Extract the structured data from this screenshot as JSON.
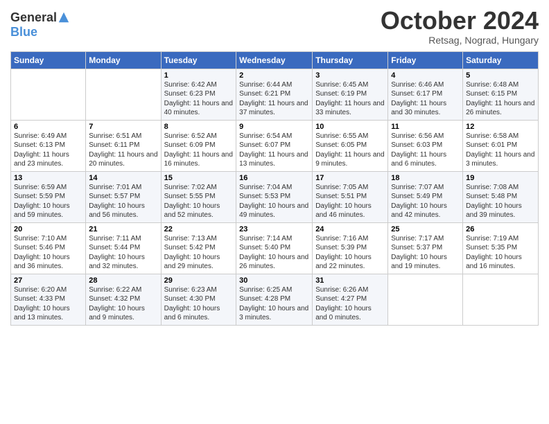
{
  "header": {
    "logo_line1": "General",
    "logo_line2": "Blue",
    "month": "October 2024",
    "location": "Retsag, Nograd, Hungary"
  },
  "days_of_week": [
    "Sunday",
    "Monday",
    "Tuesday",
    "Wednesday",
    "Thursday",
    "Friday",
    "Saturday"
  ],
  "weeks": [
    [
      {
        "day": "",
        "info": ""
      },
      {
        "day": "",
        "info": ""
      },
      {
        "day": "1",
        "info": "Sunrise: 6:42 AM\nSunset: 6:23 PM\nDaylight: 11 hours and 40 minutes."
      },
      {
        "day": "2",
        "info": "Sunrise: 6:44 AM\nSunset: 6:21 PM\nDaylight: 11 hours and 37 minutes."
      },
      {
        "day": "3",
        "info": "Sunrise: 6:45 AM\nSunset: 6:19 PM\nDaylight: 11 hours and 33 minutes."
      },
      {
        "day": "4",
        "info": "Sunrise: 6:46 AM\nSunset: 6:17 PM\nDaylight: 11 hours and 30 minutes."
      },
      {
        "day": "5",
        "info": "Sunrise: 6:48 AM\nSunset: 6:15 PM\nDaylight: 11 hours and 26 minutes."
      }
    ],
    [
      {
        "day": "6",
        "info": "Sunrise: 6:49 AM\nSunset: 6:13 PM\nDaylight: 11 hours and 23 minutes."
      },
      {
        "day": "7",
        "info": "Sunrise: 6:51 AM\nSunset: 6:11 PM\nDaylight: 11 hours and 20 minutes."
      },
      {
        "day": "8",
        "info": "Sunrise: 6:52 AM\nSunset: 6:09 PM\nDaylight: 11 hours and 16 minutes."
      },
      {
        "day": "9",
        "info": "Sunrise: 6:54 AM\nSunset: 6:07 PM\nDaylight: 11 hours and 13 minutes."
      },
      {
        "day": "10",
        "info": "Sunrise: 6:55 AM\nSunset: 6:05 PM\nDaylight: 11 hours and 9 minutes."
      },
      {
        "day": "11",
        "info": "Sunrise: 6:56 AM\nSunset: 6:03 PM\nDaylight: 11 hours and 6 minutes."
      },
      {
        "day": "12",
        "info": "Sunrise: 6:58 AM\nSunset: 6:01 PM\nDaylight: 11 hours and 3 minutes."
      }
    ],
    [
      {
        "day": "13",
        "info": "Sunrise: 6:59 AM\nSunset: 5:59 PM\nDaylight: 10 hours and 59 minutes."
      },
      {
        "day": "14",
        "info": "Sunrise: 7:01 AM\nSunset: 5:57 PM\nDaylight: 10 hours and 56 minutes."
      },
      {
        "day": "15",
        "info": "Sunrise: 7:02 AM\nSunset: 5:55 PM\nDaylight: 10 hours and 52 minutes."
      },
      {
        "day": "16",
        "info": "Sunrise: 7:04 AM\nSunset: 5:53 PM\nDaylight: 10 hours and 49 minutes."
      },
      {
        "day": "17",
        "info": "Sunrise: 7:05 AM\nSunset: 5:51 PM\nDaylight: 10 hours and 46 minutes."
      },
      {
        "day": "18",
        "info": "Sunrise: 7:07 AM\nSunset: 5:49 PM\nDaylight: 10 hours and 42 minutes."
      },
      {
        "day": "19",
        "info": "Sunrise: 7:08 AM\nSunset: 5:48 PM\nDaylight: 10 hours and 39 minutes."
      }
    ],
    [
      {
        "day": "20",
        "info": "Sunrise: 7:10 AM\nSunset: 5:46 PM\nDaylight: 10 hours and 36 minutes."
      },
      {
        "day": "21",
        "info": "Sunrise: 7:11 AM\nSunset: 5:44 PM\nDaylight: 10 hours and 32 minutes."
      },
      {
        "day": "22",
        "info": "Sunrise: 7:13 AM\nSunset: 5:42 PM\nDaylight: 10 hours and 29 minutes."
      },
      {
        "day": "23",
        "info": "Sunrise: 7:14 AM\nSunset: 5:40 PM\nDaylight: 10 hours and 26 minutes."
      },
      {
        "day": "24",
        "info": "Sunrise: 7:16 AM\nSunset: 5:39 PM\nDaylight: 10 hours and 22 minutes."
      },
      {
        "day": "25",
        "info": "Sunrise: 7:17 AM\nSunset: 5:37 PM\nDaylight: 10 hours and 19 minutes."
      },
      {
        "day": "26",
        "info": "Sunrise: 7:19 AM\nSunset: 5:35 PM\nDaylight: 10 hours and 16 minutes."
      }
    ],
    [
      {
        "day": "27",
        "info": "Sunrise: 6:20 AM\nSunset: 4:33 PM\nDaylight: 10 hours and 13 minutes."
      },
      {
        "day": "28",
        "info": "Sunrise: 6:22 AM\nSunset: 4:32 PM\nDaylight: 10 hours and 9 minutes."
      },
      {
        "day": "29",
        "info": "Sunrise: 6:23 AM\nSunset: 4:30 PM\nDaylight: 10 hours and 6 minutes."
      },
      {
        "day": "30",
        "info": "Sunrise: 6:25 AM\nSunset: 4:28 PM\nDaylight: 10 hours and 3 minutes."
      },
      {
        "day": "31",
        "info": "Sunrise: 6:26 AM\nSunset: 4:27 PM\nDaylight: 10 hours and 0 minutes."
      },
      {
        "day": "",
        "info": ""
      },
      {
        "day": "",
        "info": ""
      }
    ]
  ]
}
